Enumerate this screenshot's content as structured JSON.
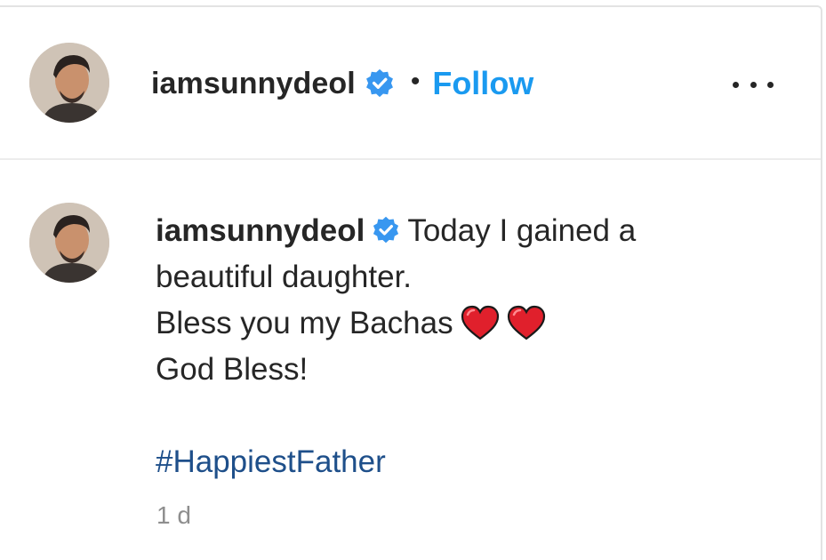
{
  "post": {
    "header": {
      "username": "iamsunnydeol",
      "separator": "•",
      "follow_label": "Follow",
      "verified_icon": "verified-badge-icon",
      "more_icon": "more-options-icon"
    },
    "caption": {
      "username": "iamsunnydeol",
      "line1": "Today I gained a",
      "line2": "beautiful daughter.",
      "line3": "Bless you my Bachas",
      "line4": "God Bless!",
      "hashtag": "#HappiestFather",
      "emoji": [
        "red-heart-icon",
        "red-heart-icon"
      ]
    },
    "timestamp": "1 d"
  },
  "colors": {
    "follow": "#1a9af0",
    "verified": "#3897f0",
    "hashtag": "#1e4f8a",
    "timestamp": "#8e8e8e",
    "heart": "#e0202c"
  }
}
